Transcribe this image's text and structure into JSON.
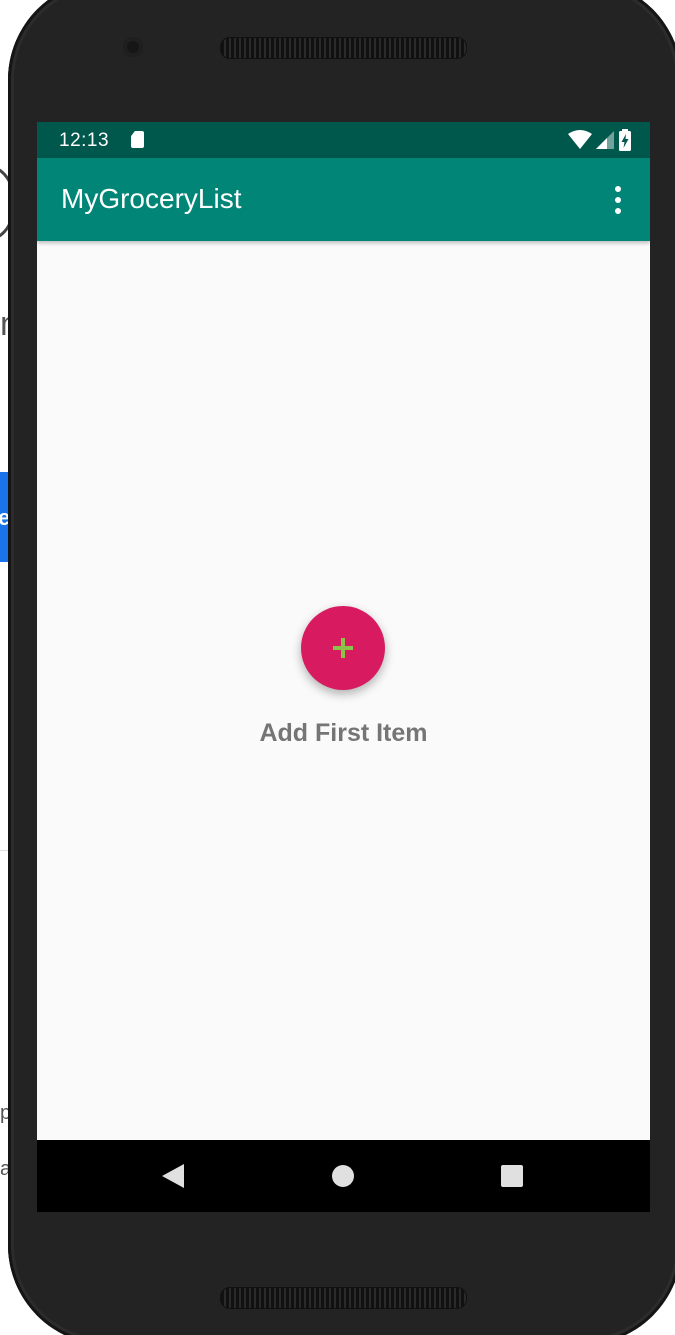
{
  "status_bar": {
    "time": "12:13",
    "icons": [
      "sd-card-icon",
      "wifi-icon",
      "cellular-signal-icon",
      "battery-charging-icon"
    ]
  },
  "app_bar": {
    "title": "MyGroceryList",
    "menu_icon": "overflow-menu-icon"
  },
  "main": {
    "add_button_icon": "plus-icon",
    "empty_label": "Add First Item"
  },
  "nav_bar": {
    "buttons": [
      "back-icon",
      "home-icon",
      "recents-icon"
    ]
  },
  "colors": {
    "status_bar": "#00574b",
    "app_bar": "#008577",
    "fab": "#d81b60",
    "fab_icon": "#8bc34a",
    "screen_bg": "#fafafa",
    "label_text": "#757575"
  }
}
